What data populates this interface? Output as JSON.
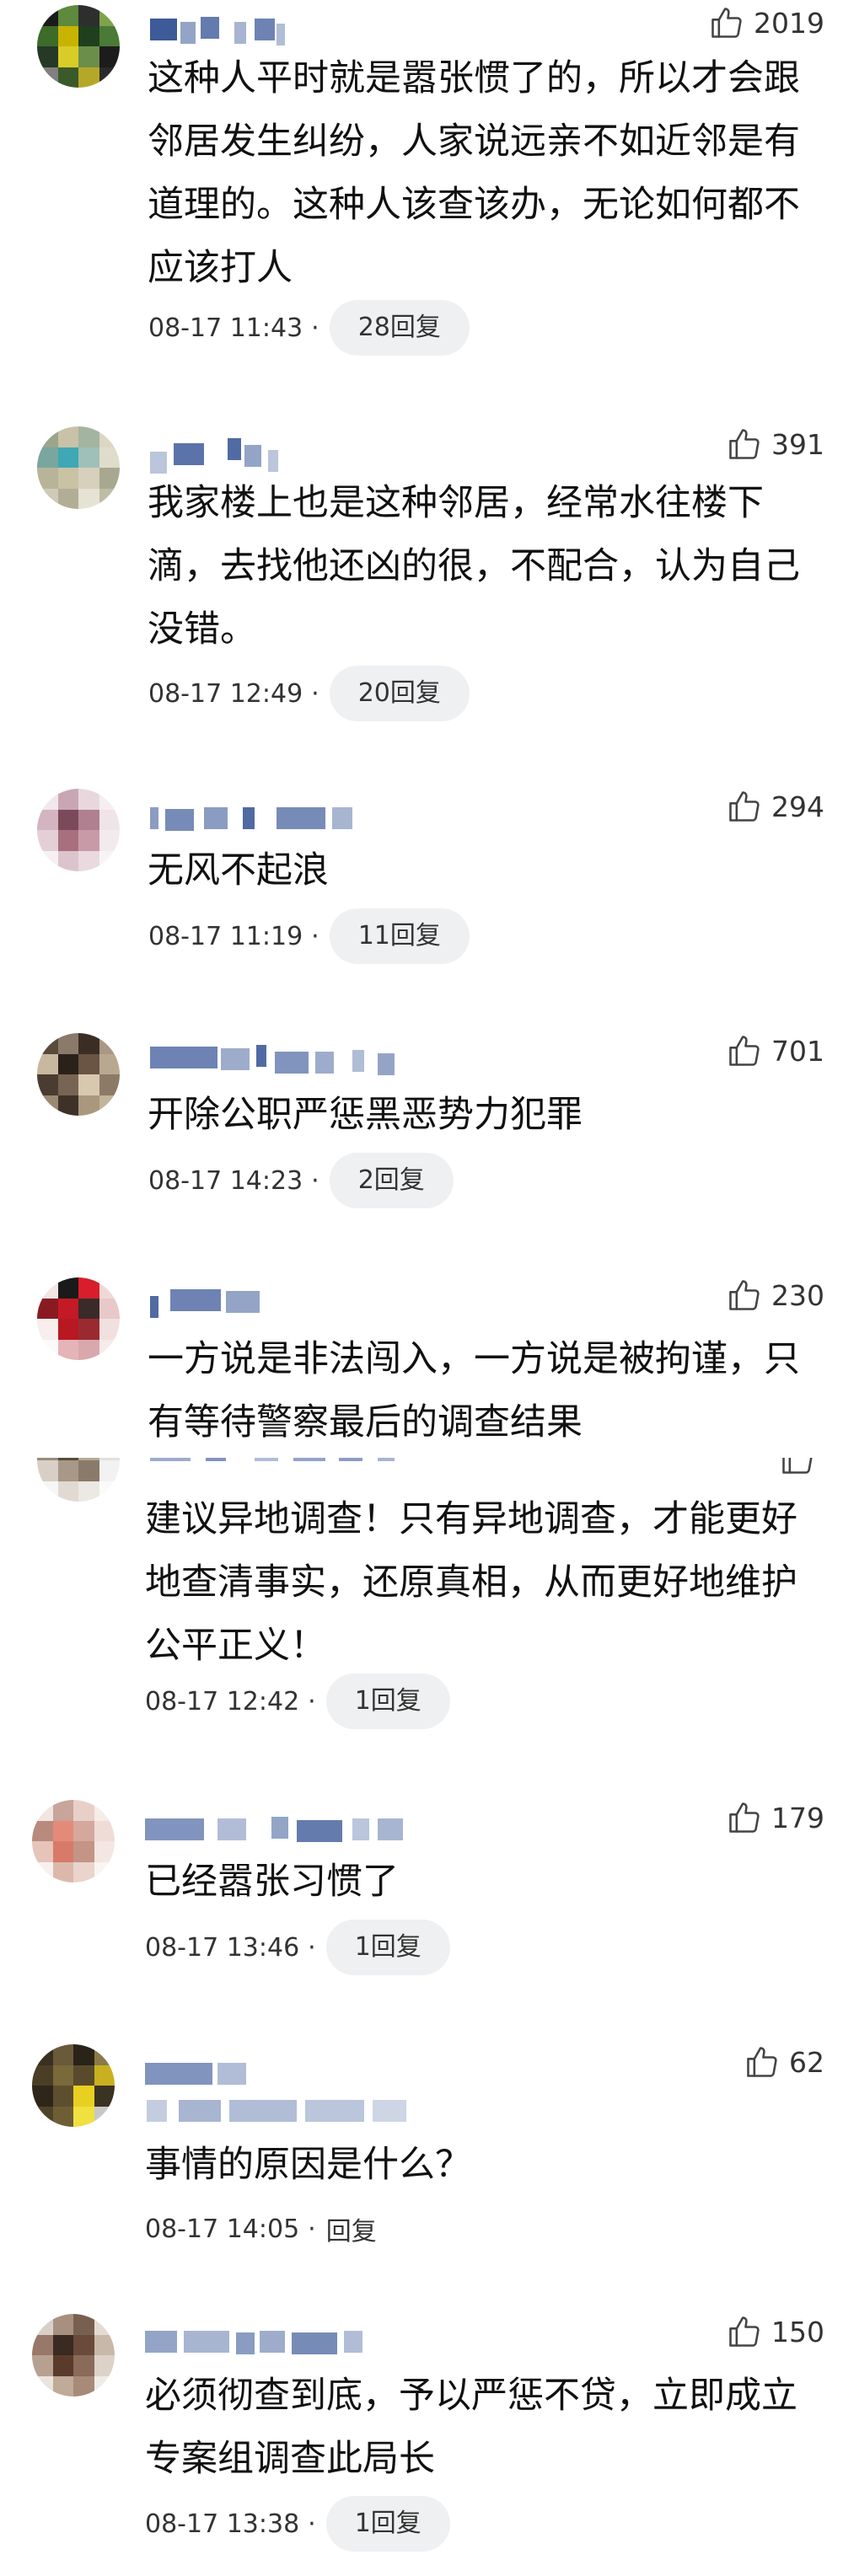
{
  "comments": [
    {
      "likes": "2019",
      "text": "这种人平时就是嚣张惯了的，所以才会跟邻居发生纠纷，人家说远亲不如近邻是有道理的。这种人该查该办，无论如何都不应该打人",
      "time": "08-17 11:43",
      "reply": "28回复",
      "reply_style": "pill"
    },
    {
      "likes": "391",
      "text": "我家楼上也是这种邻居，经常水往楼下滴，去找他还凶的很，不配合，认为自己没错。",
      "time": "08-17 12:49",
      "reply": "20回复",
      "reply_style": "pill"
    },
    {
      "likes": "294",
      "text": "无风不起浪",
      "time": "08-17 11:19",
      "reply": "11回复",
      "reply_style": "pill"
    },
    {
      "likes": "701",
      "text": "开除公职严惩黑恶势力犯罪",
      "time": "08-17 14:23",
      "reply": "2回复",
      "reply_style": "pill"
    },
    {
      "likes": "230",
      "text": "一方说是非法闯入，一方说是被拘谨，只有等待警察最后的调查结果"
    },
    {
      "likes": "",
      "text": "建议异地调查！只有异地调查，才能更好地查清事实，还原真相，从而更好地维护公平正义！",
      "time": "08-17 12:42",
      "reply": "1回复",
      "reply_style": "pill"
    },
    {
      "likes": "179",
      "text": "已经嚣张习惯了",
      "time": "08-17 13:46",
      "reply": "1回复",
      "reply_style": "pill"
    },
    {
      "likes": "62",
      "text": "事情的原因是什么？",
      "time": "08-17 14:05",
      "reply": "回复",
      "reply_style": "plain"
    },
    {
      "likes": "150",
      "text": "必须彻查到底，予以严惩不贷，立即成立专案组调查此局长",
      "time": "08-17 13:38",
      "reply": "1回复",
      "reply_style": "pill"
    }
  ],
  "colors": {
    "text": "#111111",
    "meta": "#333333",
    "pill_bg": "#eef0f2",
    "mosaic": "#3d5a99"
  },
  "icons": {
    "like": "thumbs-up-icon"
  }
}
